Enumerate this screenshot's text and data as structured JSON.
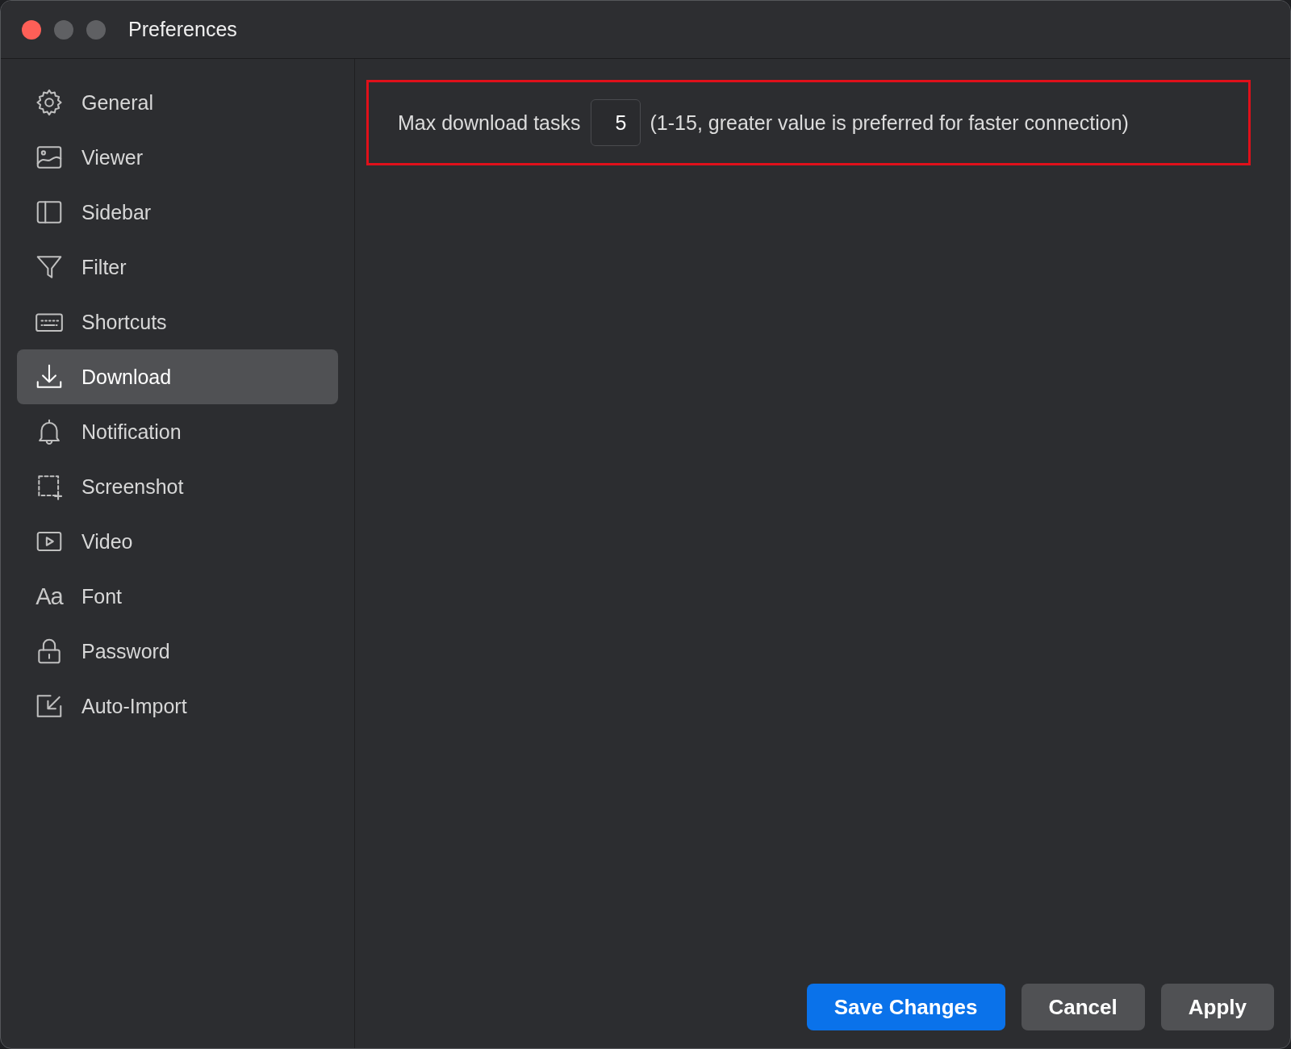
{
  "window": {
    "title": "Preferences"
  },
  "sidebar": {
    "items": [
      {
        "label": "General",
        "selected": false
      },
      {
        "label": "Viewer",
        "selected": false
      },
      {
        "label": "Sidebar",
        "selected": false
      },
      {
        "label": "Filter",
        "selected": false
      },
      {
        "label": "Shortcuts",
        "selected": false
      },
      {
        "label": "Download",
        "selected": true
      },
      {
        "label": "Notification",
        "selected": false
      },
      {
        "label": "Screenshot",
        "selected": false
      },
      {
        "label": "Video",
        "selected": false
      },
      {
        "label": "Font",
        "glyph": "Aa",
        "selected": false
      },
      {
        "label": "Password",
        "selected": false
      },
      {
        "label": "Auto-Import",
        "selected": false
      }
    ]
  },
  "setting": {
    "label": "Max download tasks",
    "value": "5",
    "hint": "(1-15, greater value is preferred for faster connection)",
    "highlighted": true
  },
  "buttons": [
    {
      "label": "Save Changes",
      "kind": "primary"
    },
    {
      "label": "Cancel",
      "kind": "secondary"
    },
    {
      "label": "Apply",
      "kind": "secondary"
    }
  ]
}
